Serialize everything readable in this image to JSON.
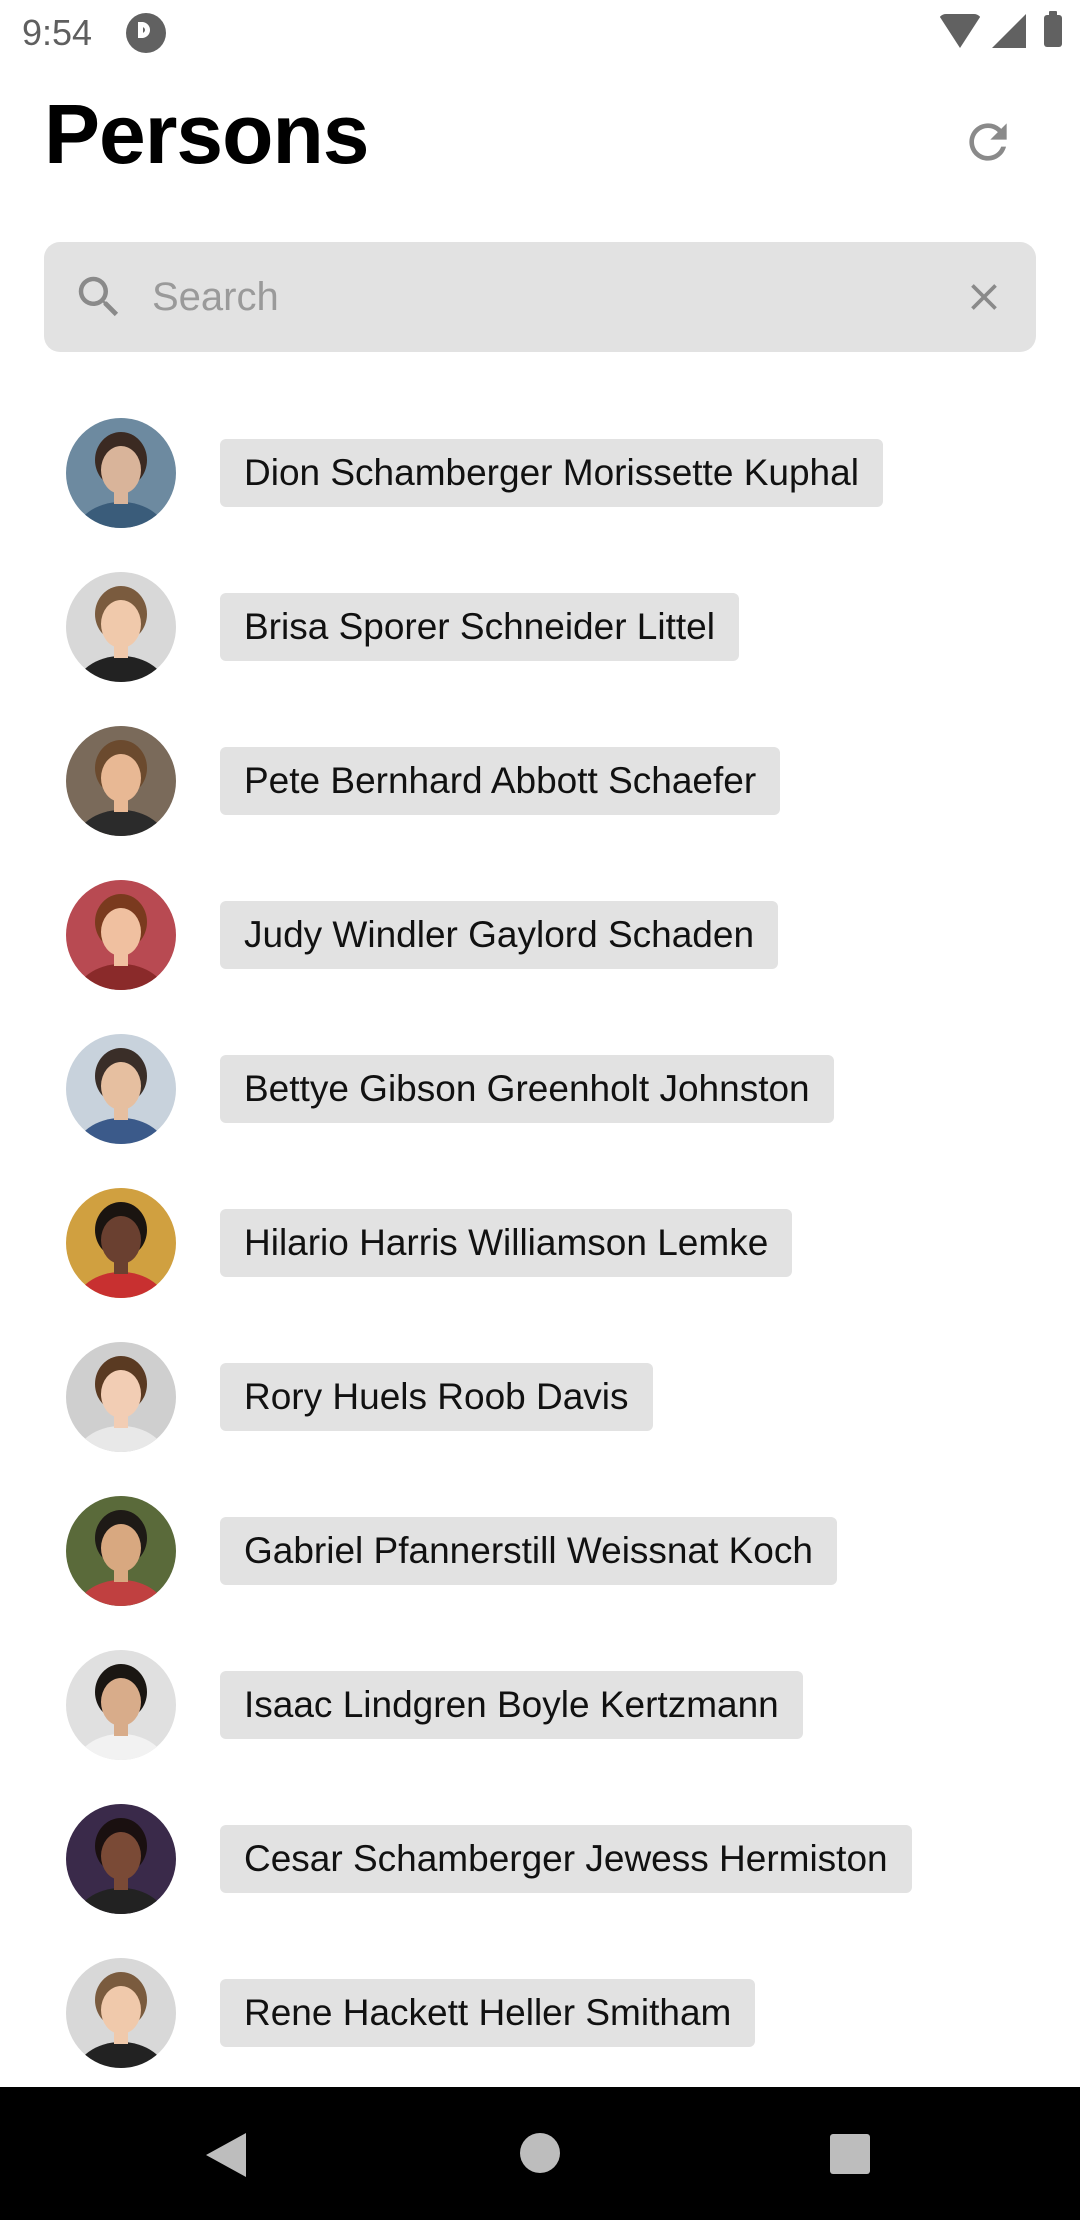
{
  "status_bar": {
    "time": "9:54",
    "icons": [
      "app-notification-icon",
      "wifi-icon",
      "signal-icon",
      "battery-icon"
    ],
    "icon_color": "#616161"
  },
  "header": {
    "title": "Persons",
    "refresh_icon": "refresh-icon"
  },
  "search": {
    "value": "",
    "placeholder": "Search",
    "search_icon": "search-icon",
    "clear_icon": "close-icon",
    "background": "#e2e2e2"
  },
  "persons": [
    {
      "name": "Dion Schamberger Morissette Kuphal",
      "avatar_colors": {
        "bg": "#6d8aa0",
        "hair": "#3b2a22",
        "skin": "#d9b49a",
        "shirt": "#3a5c7a"
      }
    },
    {
      "name": "Brisa Sporer Schneider Littel",
      "avatar_colors": {
        "bg": "#d8d8d8",
        "hair": "#7a5b3e",
        "skin": "#f0c9ab",
        "shirt": "#222222"
      }
    },
    {
      "name": "Pete Bernhard Abbott Schaefer",
      "avatar_colors": {
        "bg": "#7a6a5a",
        "hair": "#6b4a2e",
        "skin": "#e8b894",
        "shirt": "#2b2b2b"
      }
    },
    {
      "name": "Judy Windler Gaylord Schaden",
      "avatar_colors": {
        "bg": "#b84a52",
        "hair": "#7a3a1e",
        "skin": "#f0c0a0",
        "shirt": "#8a2a2a"
      }
    },
    {
      "name": "Bettye Gibson Greenholt Johnston",
      "avatar_colors": {
        "bg": "#c8d2dc",
        "hair": "#3a2e28",
        "skin": "#e6bfa0",
        "shirt": "#3b5a8a"
      }
    },
    {
      "name": "Hilario Harris Williamson Lemke",
      "avatar_colors": {
        "bg": "#d0a040",
        "hair": "#1a1410",
        "skin": "#6a4030",
        "shirt": "#c83030"
      }
    },
    {
      "name": "Rory Huels Roob Davis",
      "avatar_colors": {
        "bg": "#cfcfcf",
        "hair": "#5a3a22",
        "skin": "#f2cdb4",
        "shirt": "#e8e8e8"
      }
    },
    {
      "name": "Gabriel Pfannerstill Weissnat Koch",
      "avatar_colors": {
        "bg": "#5a6a3a",
        "hair": "#1e1a16",
        "skin": "#d8a880",
        "shirt": "#c04040"
      }
    },
    {
      "name": "Isaac Lindgren Boyle Kertzmann",
      "avatar_colors": {
        "bg": "#e0e0e0",
        "hair": "#1a1612",
        "skin": "#d8ac8a",
        "shirt": "#f2f2f2"
      }
    },
    {
      "name": "Cesar Schamberger Jewess Hermiston",
      "avatar_colors": {
        "bg": "#3a2a4a",
        "hair": "#1a1010",
        "skin": "#7a4a36",
        "shirt": "#222222"
      }
    },
    {
      "name": "Rene Hackett Heller Smitham",
      "avatar_colors": {
        "bg": "#d8d8d8",
        "hair": "#7a5b3e",
        "skin": "#f0c9ab",
        "shirt": "#222222"
      }
    }
  ],
  "nav_bar": {
    "back_icon": "back-triangle-icon",
    "home_icon": "home-circle-icon",
    "recents_icon": "recents-square-icon"
  }
}
